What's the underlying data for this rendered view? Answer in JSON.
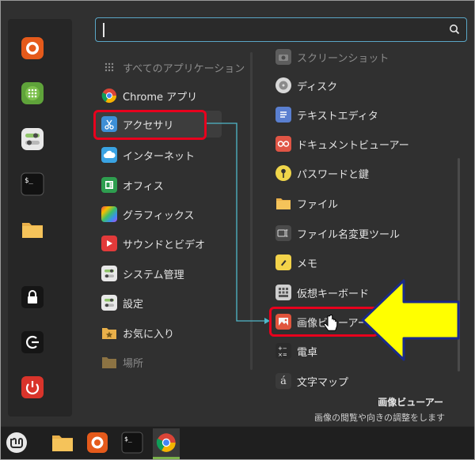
{
  "search": {
    "value": ""
  },
  "favorites": [
    {
      "name": "firefox-icon"
    },
    {
      "name": "calculator-icon"
    },
    {
      "name": "settings-icon"
    },
    {
      "name": "terminal-icon"
    },
    {
      "name": "folder-icon"
    },
    {
      "name": "lock-icon"
    },
    {
      "name": "logout-icon"
    },
    {
      "name": "power-icon"
    }
  ],
  "categories": [
    {
      "label": "すべてのアプリケーション"
    },
    {
      "label": "Chrome アプリ"
    },
    {
      "label": "アクセサリ"
    },
    {
      "label": "インターネット"
    },
    {
      "label": "オフィス"
    },
    {
      "label": "グラフィックス"
    },
    {
      "label": "サウンドとビデオ"
    },
    {
      "label": "システム管理"
    },
    {
      "label": "設定"
    },
    {
      "label": "お気に入り"
    },
    {
      "label": "場所"
    }
  ],
  "apps": [
    {
      "label": "スクリーンショット"
    },
    {
      "label": "ディスク"
    },
    {
      "label": "テキストエディタ"
    },
    {
      "label": "ドキュメントビューアー"
    },
    {
      "label": "パスワードと鍵"
    },
    {
      "label": "ファイル"
    },
    {
      "label": "ファイル名変更ツール"
    },
    {
      "label": "メモ"
    },
    {
      "label": "仮想キーボード"
    },
    {
      "label": "画像ビューアー"
    },
    {
      "label": "電卓"
    },
    {
      "label": "文字マップ"
    }
  ],
  "description": {
    "title": "画像ビューアー",
    "text": "画像の閲覧や向きの調整をします"
  },
  "colors": {
    "highlight": "#e8001d",
    "arrow_fill": "#ffff00",
    "arrow_stroke": "#1a2a8a",
    "connector": "#4fb7c9",
    "accent": "#5aa6c6"
  },
  "taskbar": [
    {
      "name": "mint-menu-icon"
    },
    {
      "name": "files-icon"
    },
    {
      "name": "firefox-icon"
    },
    {
      "name": "terminal-icon"
    },
    {
      "name": "chrome-icon"
    }
  ]
}
